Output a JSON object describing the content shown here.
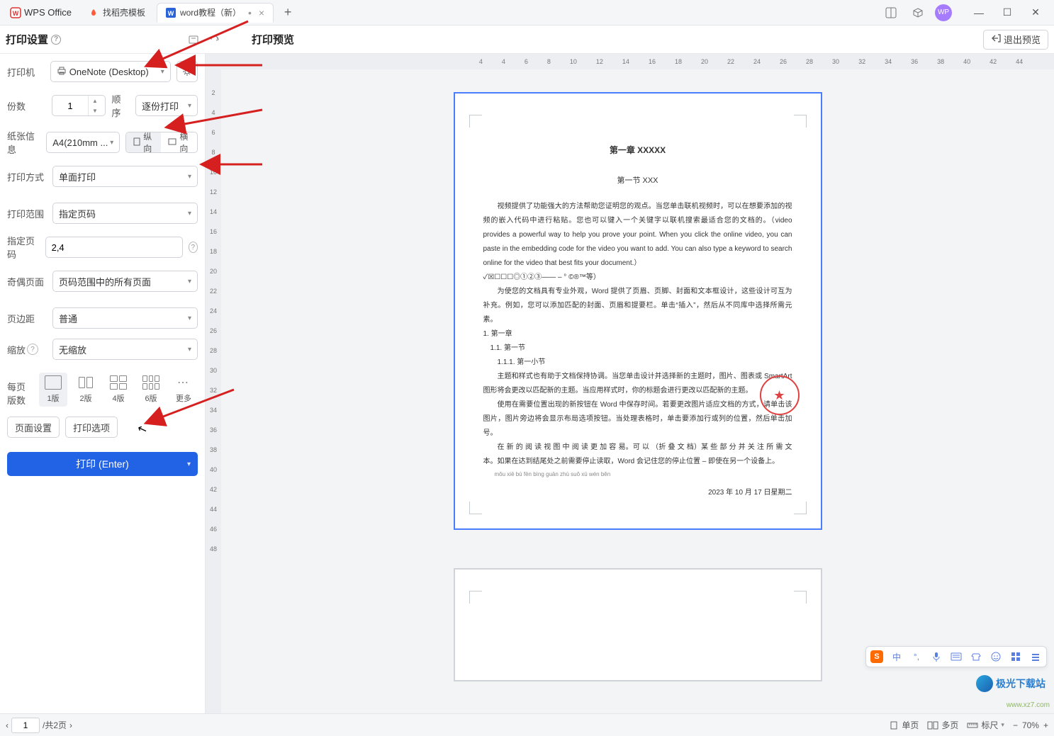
{
  "app": {
    "name": "WPS Office"
  },
  "tabs": [
    {
      "icon": "flame",
      "label": "找稻壳模板"
    },
    {
      "icon": "word",
      "label": "word教程（新）",
      "active": true
    }
  ],
  "titlebar": {
    "avatar": "WP"
  },
  "header": {
    "settings_title": "打印设置",
    "preview_title": "打印预览",
    "exit_preview": "退出预览"
  },
  "settings": {
    "printer": {
      "label": "打印机",
      "value": "OneNote (Desktop)"
    },
    "copies": {
      "label": "份数",
      "value": "1",
      "order_label": "顺序",
      "order_value": "逐份打印"
    },
    "paper": {
      "label": "纸张信息",
      "value": "A4(210mm ...",
      "portrait": "纵向",
      "landscape": "横向"
    },
    "duplex": {
      "label": "打印方式",
      "value": "单面打印"
    },
    "range": {
      "label": "打印范围",
      "value": "指定页码"
    },
    "pages": {
      "label": "指定页码",
      "value": "2,4"
    },
    "parity": {
      "label": "奇偶页面",
      "value": "页码范围中的所有页面"
    },
    "margin": {
      "label": "页边距",
      "value": "普通"
    },
    "scale": {
      "label": "缩放",
      "value": "无缩放"
    },
    "perpage": {
      "label": "每页版数",
      "options": [
        "1版",
        "2版",
        "4版",
        "6版",
        "更多"
      ]
    },
    "page_setup": "页面设置",
    "print_options": "打印选项",
    "print_button": "打印 (Enter)"
  },
  "ruler_h": [
    "4",
    "4",
    "6",
    "8",
    "10",
    "12",
    "14",
    "16",
    "18",
    "20",
    "22",
    "24",
    "26",
    "28",
    "30",
    "32",
    "34",
    "36",
    "38",
    "40",
    "42",
    "44"
  ],
  "ruler_v": [
    "2",
    "4",
    "6",
    "8",
    "10",
    "12",
    "14",
    "16",
    "18",
    "20",
    "22",
    "24",
    "26",
    "28",
    "30",
    "32",
    "34",
    "36",
    "38",
    "40",
    "42",
    "44",
    "46",
    "48"
  ],
  "document": {
    "title": "第一章  XXXXX",
    "subtitle": "第一节  XXX",
    "para1": "视频提供了功能强大的方法帮助您证明您的观点。当您单击联机视频时，可以在想要添加的视频的嵌入代码中进行粘贴。您也可以键入一个关键字以联机搜索最适合您的文档的。（video provides a powerful way to help you prove your point. When you click the online video, you can paste in the embedding code for the video you want to add. You can also type a keyword to search online for the video that best fits your document.）",
    "symline": "✓☒☐☐☐◎①②③—— –   °  ©®™等）",
    "para2": "为使您的文档具有专业外观，Word 提供了页眉、页脚、封面和文本框设计，这些设计可互为补充。例如，您可以添加匹配的封面、页眉和提要栏。单击“插入”，然后从不同库中选择所需元素。",
    "l1": "1.   第一章",
    "l2": "1.1.   第一节",
    "l3": "1.1.1.   第一小节",
    "para3": "主题和样式也有助于文档保持协调。当您单击设计并选择新的主题时，图片、图表或 SmartArt 图形将会更改以匹配新的主题。当应用样式时，你的标题会进行更改以匹配新的主题。",
    "para4": "使用在需要位置出现的新按钮在 Word 中保存时间。若要更改图片适应文档的方式，请单击该图片，图片旁边将会显示布局选项按钮。当处理表格时，单击要添加行或列的位置，然后单击加号。",
    "para5": "在 新 的 阅 读 视 图 中 阅 读 更 加 容 易。可 以 （折 叠 文 档）某 些 部 分 并 关 注 所 需 文 本。如果在达到结尾处之前需要停止读取，Word 会记住您的停止位置 – 即使在另一个设备上。",
    "pinyin": "mǒu xiē bù fēn bìng guān zhù suǒ xū wén běn",
    "date_line": "2023 年 10 月 17 日星期二"
  },
  "status": {
    "prev": "<",
    "next": ">",
    "page_input": "1",
    "page_total": "/共2页",
    "single": "单页",
    "multi": "多页",
    "scale_lbl": "标尺",
    "zoom": "70%"
  },
  "ime": {
    "letters": "中"
  },
  "watermark": {
    "site": "极光下载站",
    "url": "www.xz7.com"
  }
}
